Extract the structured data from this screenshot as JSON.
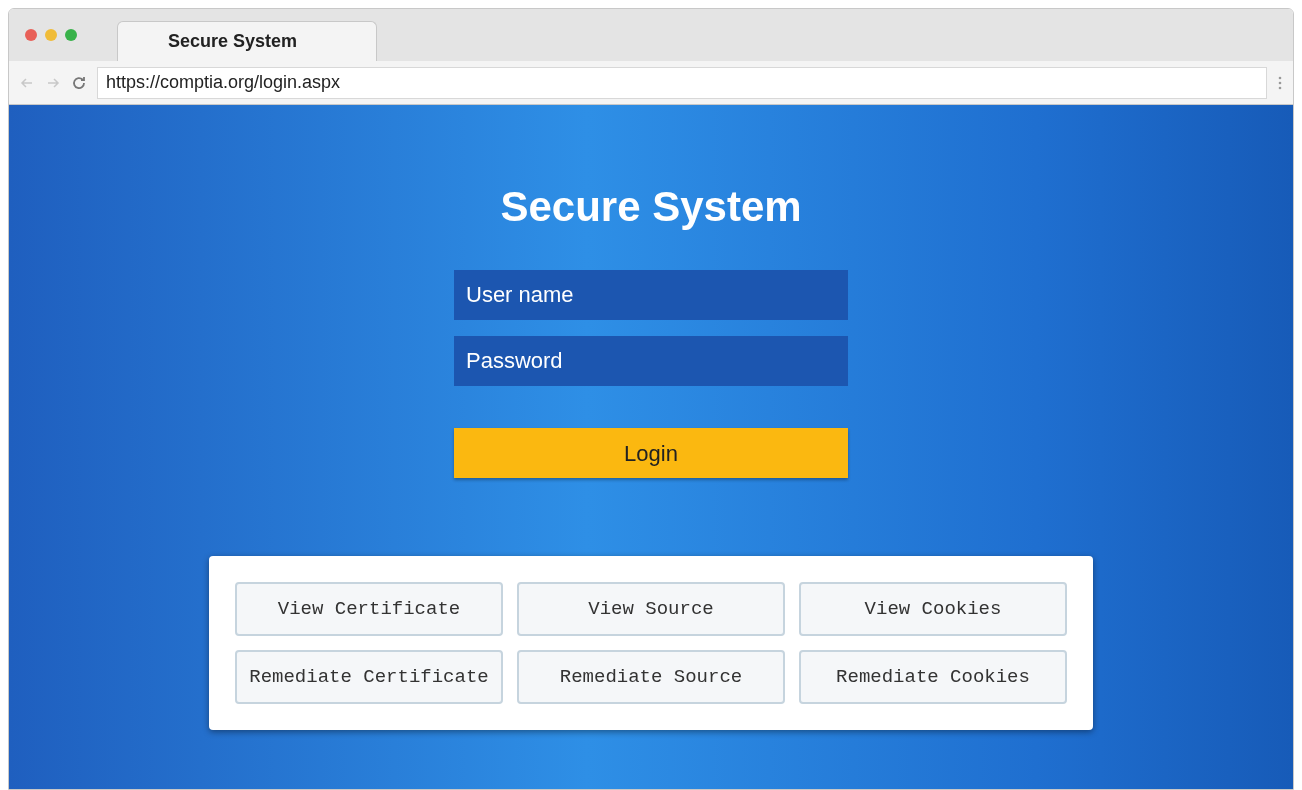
{
  "tab": {
    "title": "Secure System"
  },
  "address_bar": {
    "url": "https://comptia.org/login.aspx"
  },
  "login": {
    "title": "Secure System",
    "username": {
      "placeholder": "User name"
    },
    "password": {
      "placeholder": "Password"
    },
    "button": "Login"
  },
  "actions": [
    {
      "label": "View Certificate"
    },
    {
      "label": "View Source"
    },
    {
      "label": "View Cookies"
    },
    {
      "label": "Remediate Certificate"
    },
    {
      "label": "Remediate Source"
    },
    {
      "label": "Remediate Cookies"
    }
  ]
}
